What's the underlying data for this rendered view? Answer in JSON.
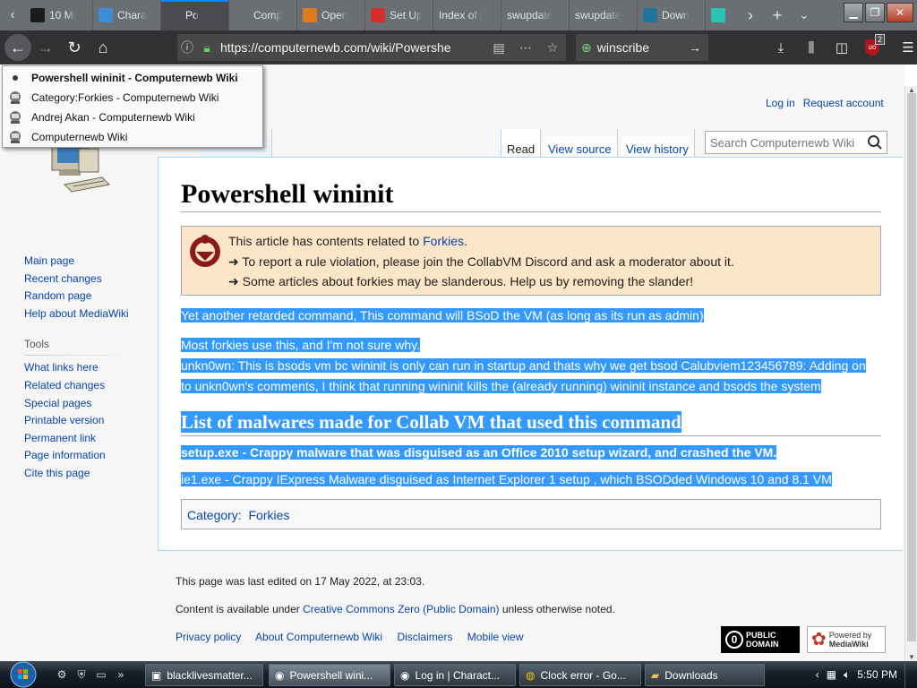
{
  "browser": {
    "tabs": [
      {
        "label": "10 Mi",
        "favicon": "10-icon",
        "color": "#1b1b1b"
      },
      {
        "label": "Chara",
        "favicon": "chara-icon",
        "color": "#3b8fd8"
      },
      {
        "label": "Po",
        "favicon": "computernewb-icon",
        "color": "#4a4a4f",
        "active": true
      },
      {
        "label": "Comp",
        "favicon": "computernewb-icon",
        "color": "#6b6f73"
      },
      {
        "label": "Open",
        "favicon": "openvpn-icon",
        "color": "#e07a1f"
      },
      {
        "label": "Set Up",
        "favicon": "setup-icon",
        "color": "#d0312d"
      },
      {
        "label": "Index of /",
        "favicon": "",
        "color": ""
      },
      {
        "label": "swupdate",
        "favicon": "",
        "color": ""
      },
      {
        "label": "swupdate",
        "favicon": "",
        "color": ""
      },
      {
        "label": "Down",
        "favicon": "wordpress-icon",
        "color": "#21759b"
      },
      {
        "label": "",
        "favicon": "teal-icon",
        "color": "#29c4b4"
      }
    ],
    "url": "https://computernewb.com/wiki/Powershe",
    "search_value": "winscribe",
    "ublock_badge": "2"
  },
  "autocomplete": {
    "items": [
      "Powershell wininit - Computernewb Wiki",
      "Category:Forkies - Computernewb Wiki",
      "Andrej Akan - Computernewb Wiki",
      "Computernewb Wiki"
    ]
  },
  "wiki": {
    "personal": {
      "login": "Log in",
      "request": "Request account"
    },
    "tabs": {
      "read": "Read",
      "view_source": "View source",
      "view_history": "View history"
    },
    "search_placeholder": "Search Computernewb Wiki",
    "sidebar": {
      "nav": [
        "Main page",
        "Recent changes",
        "Random page",
        "Help about MediaWiki"
      ],
      "tools_heading": "Tools",
      "tools": [
        "What links here",
        "Related changes",
        "Special pages",
        "Printable version",
        "Permanent link",
        "Page information",
        "Cite this page"
      ]
    },
    "title": "Powershell wininit",
    "notice": {
      "line1_prefix": "This article has contents related to ",
      "line1_link": "Forkies",
      "line1_suffix": ".",
      "line2": "➜ To report a rule violation, please join the CollabVM Discord and ask a moderator about it.",
      "line3": "➜ Some articles about forkies may be slanderous. Help us by removing the slander!"
    },
    "p1": "Yet another retarded command, This command will BSoD the VM (as long as its run as admin)",
    "p2_line1": "Most forkies use this, and I'm not sure why.",
    "p2_line2": "unkn0wn: This is bsods vm bc wininit is only can run in startup and thats why we get bsod Calubviem123456789: Adding on",
    "p2_line3": "to unkn0wn's comments, I think that running wininit kills the (already running) wininit instance and bsods the system",
    "h2": "List of malwares made for Collab VM that used this command",
    "p3": "setup.exe - Crappy malware that was disguised as an Office 2010 setup wizard, and crashed the VM.",
    "p4": "ie1.exe - Crappy IExpress Malware disguised as Internet Explorer 1 setup , which BSODded Windows 10 and 8.1 VM",
    "category_label": "Category:",
    "category_link": "Forkies",
    "footer": {
      "last_edited": "This page was last edited on 17 May 2022, at 23:03.",
      "license_prefix": "Content is available under ",
      "license_link": "Creative Commons Zero (Public Domain)",
      "license_suffix": " unless otherwise noted.",
      "links": [
        "Privacy policy",
        "About Computernewb Wiki",
        "Disclaimers",
        "Mobile view"
      ],
      "badge_pd": [
        "PUBLIC",
        "DOMAIN"
      ],
      "badge_mw": [
        "Powered by",
        "MediaWiki"
      ]
    }
  },
  "taskbar": {
    "buttons": [
      "blacklivesmatter...",
      "Powershell wini...",
      "Log in | Charact...",
      "Clock error - Go...",
      "Downloads"
    ],
    "active_index": 1,
    "clock": "5:50 PM"
  }
}
